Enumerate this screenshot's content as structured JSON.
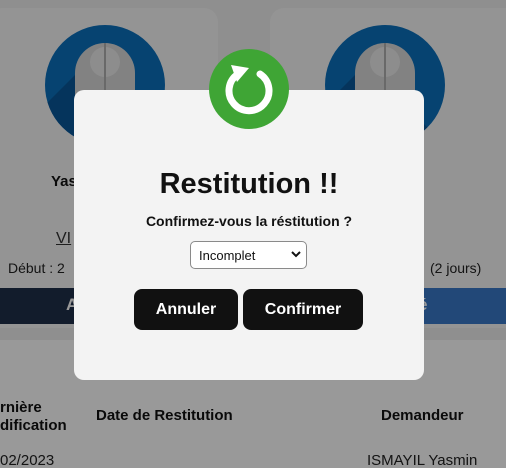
{
  "cards": [
    {
      "name": "Yas",
      "link": "VI",
      "date": "Début : 2",
      "action": "A"
    },
    {
      "name": "",
      "link": "",
      "date": "(2 jours)",
      "action": "é"
    }
  ],
  "table": {
    "headers": [
      "rnière\ndification",
      "Date de Restitution",
      "Demandeur"
    ],
    "rows": [
      {
        "modification": "02/2023",
        "restitution": "",
        "demandeur": "ISMAYIL Yasmin"
      }
    ]
  },
  "modal": {
    "icon": "restore-icon",
    "title": "Restitution !!",
    "question": "Confirmez-vous la réstitution ?",
    "select": {
      "value": "Incomplet",
      "options": [
        "Incomplet"
      ]
    },
    "cancel_label": "Annuler",
    "confirm_label": "Confirmer"
  },
  "colors": {
    "overlay": "#000000",
    "modal_bg": "#f3f3f3",
    "icon_green": "#3fa535",
    "button_bg": "#111111",
    "avatar_blue": "#0b70bd"
  }
}
